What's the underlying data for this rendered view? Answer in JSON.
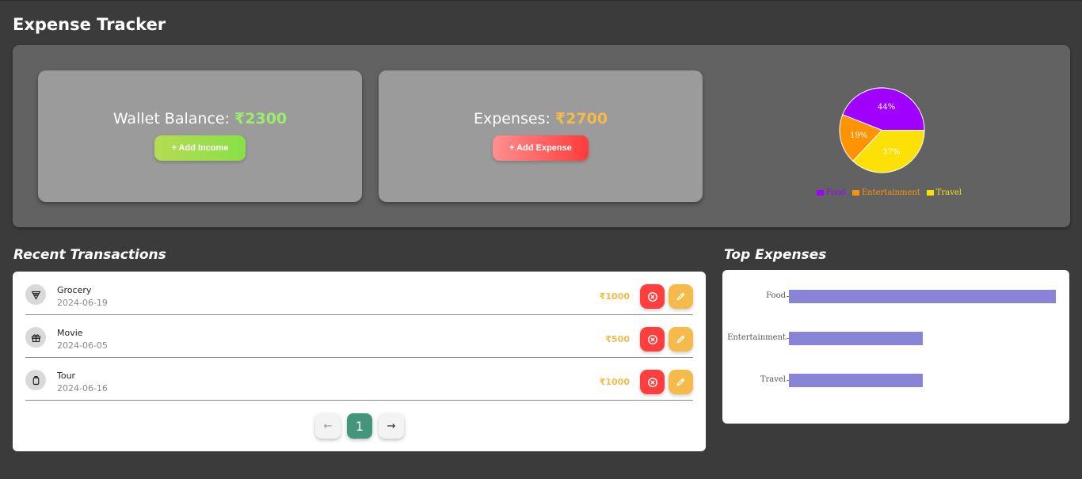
{
  "app": {
    "title": "Expense Tracker"
  },
  "wallet": {
    "label": "Wallet Balance: ",
    "amount": "₹2300",
    "button": "+ Add Income"
  },
  "expenses": {
    "label": "Expenses: ",
    "amount": "₹2700",
    "button": "+ Add Expense"
  },
  "pie": {
    "slices": [
      {
        "name": "Food",
        "percent": 44,
        "label": "44%",
        "color": "#a000ff"
      },
      {
        "name": "Entertainment",
        "percent": 19,
        "label": "19%",
        "color": "#ff9304"
      },
      {
        "name": "Travel",
        "percent": 37,
        "label": "37%",
        "color": "#fde006"
      }
    ]
  },
  "recent": {
    "title": "Recent Transactions",
    "items": [
      {
        "name": "Grocery",
        "date": "2024-06-19",
        "amount": "₹1000",
        "icon": "pizza-icon"
      },
      {
        "name": "Movie",
        "date": "2024-06-05",
        "amount": "₹500",
        "icon": "gift-icon"
      },
      {
        "name": "Tour",
        "date": "2024-06-16",
        "amount": "₹1000",
        "icon": "luggage-icon"
      }
    ],
    "pagination": {
      "prev": "←",
      "page": "1",
      "next": "→"
    }
  },
  "top": {
    "title": "Top Expenses",
    "bars": [
      {
        "name": "Food",
        "value": 1
      },
      {
        "name": "Entertainment",
        "value": 0.5
      },
      {
        "name": "Travel",
        "value": 0.5
      }
    ]
  },
  "colors": {
    "income_green": "#9bed6b",
    "expense_orange": "#f4bb4a",
    "delete_red": "#ff3e3e",
    "bar_purple": "#8884d8",
    "page_active": "#43967b"
  }
}
